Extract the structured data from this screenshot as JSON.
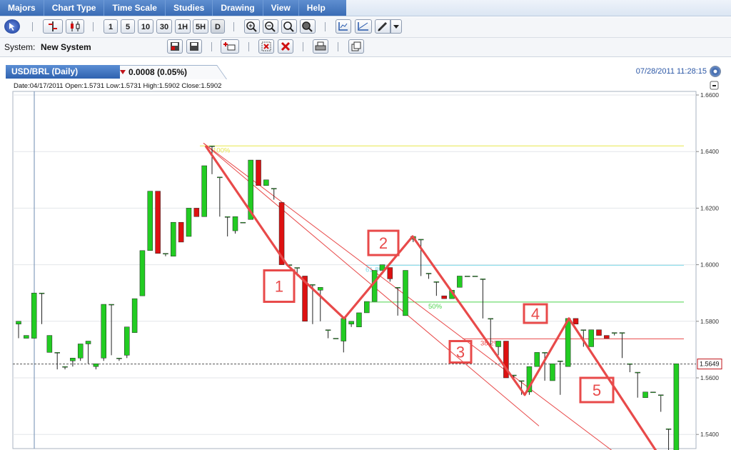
{
  "menu": [
    "Majors",
    "Chart Type",
    "Time Scale",
    "Studies",
    "Drawing",
    "View",
    "Help"
  ],
  "toolbar": {
    "period_buttons": [
      "1",
      "5",
      "10",
      "30",
      "1H",
      "5H",
      "D"
    ]
  },
  "system": {
    "label": "System:",
    "name": "New System"
  },
  "tab": {
    "title": "USD/BRL (Daily)",
    "change": "0.0008 (0.05%)",
    "datetime": "07/28/2011 11:28:15"
  },
  "ohlc_header": "Date:04/17/2011 Open:1.5731 Low:1.5731 High:1.5902 Close:1.5902",
  "colors": {
    "up": "#22cc22",
    "down": "#dd1111",
    "wave": "#e84a4a",
    "fib_100": "#e8e84a",
    "fib_618": "#7fd9e8",
    "fib_50": "#4cd44c",
    "fib_382": "#e84a4a"
  },
  "chart_data": {
    "type": "candlestick",
    "ylim": [
      1.53,
      1.66
    ],
    "y_ticks": [
      "1.6600",
      "1.6400",
      "1.6200",
      "1.6000",
      "1.5800",
      "1.5600",
      "1.5400"
    ],
    "current_price": "1.5649",
    "fib_labels": [
      "100%",
      "61.8%",
      "50%",
      "38.2%"
    ],
    "wave_labels": [
      "1",
      "2",
      "3",
      "4",
      "5"
    ],
    "candles": [
      [
        1.579,
        1.58,
        1.574,
        1.574
      ],
      [
        1.574,
        1.575,
        1.574,
        1.574
      ],
      [
        1.574,
        1.59,
        1.574,
        1.59
      ],
      [
        1.59,
        1.59,
        1.579,
        1.579
      ],
      [
        1.569,
        1.575,
        1.569,
        1.575
      ],
      [
        1.569,
        1.569,
        1.563,
        1.563
      ],
      [
        1.564,
        1.564,
        1.563,
        1.564
      ],
      [
        1.566,
        1.567,
        1.564,
        1.567
      ],
      [
        1.567,
        1.572,
        1.566,
        1.572
      ],
      [
        1.572,
        1.573,
        1.565,
        1.565
      ],
      [
        1.564,
        1.565,
        1.563,
        1.565
      ],
      [
        1.567,
        1.586,
        1.566,
        1.586
      ],
      [
        1.586,
        1.586,
        1.568,
        1.568
      ],
      [
        1.567,
        1.567,
        1.566,
        1.567
      ],
      [
        1.568,
        1.578,
        1.567,
        1.578
      ],
      [
        1.576,
        1.588,
        1.576,
        1.588
      ],
      [
        1.589,
        1.605,
        1.589,
        1.605
      ],
      [
        1.605,
        1.626,
        1.605,
        1.626
      ],
      [
        1.626,
        1.604,
        1.604,
        1.605
      ],
      [
        1.604,
        1.604,
        1.603,
        1.604
      ],
      [
        1.603,
        1.615,
        1.603,
        1.615
      ],
      [
        1.615,
        1.608,
        1.608,
        1.608
      ],
      [
        1.61,
        1.62,
        1.61,
        1.62
      ],
      [
        1.62,
        1.617,
        1.617,
        1.617
      ],
      [
        1.617,
        1.635,
        1.617,
        1.635
      ],
      [
        1.642,
        1.642,
        1.632,
        1.632
      ],
      [
        1.631,
        1.631,
        1.617,
        1.617
      ],
      [
        1.617,
        1.617,
        1.61,
        1.611
      ],
      [
        1.612,
        1.617,
        1.611,
        1.616
      ],
      [
        1.615,
        1.615,
        1.615,
        1.615
      ],
      [
        1.616,
        1.637,
        1.616,
        1.637
      ],
      [
        1.637,
        1.628,
        1.628,
        1.628
      ],
      [
        1.628,
        1.63,
        1.628,
        1.63
      ],
      [
        1.627,
        1.627,
        1.623,
        1.623
      ],
      [
        1.622,
        1.6,
        1.6,
        1.6
      ],
      [
        1.6,
        1.6,
        1.6,
        1.6
      ],
      [
        1.599,
        1.599,
        1.596,
        1.596
      ],
      [
        1.596,
        1.58,
        1.58,
        1.58
      ],
      [
        1.593,
        1.593,
        1.579,
        1.579
      ],
      [
        1.591,
        1.592,
        1.58,
        1.58
      ],
      [
        1.577,
        1.577,
        1.574,
        1.574
      ],
      [
        1.574,
        1.574,
        1.574,
        1.574
      ],
      [
        1.573,
        1.581,
        1.569,
        1.581
      ],
      [
        1.579,
        1.58,
        1.578,
        1.58
      ],
      [
        1.578,
        1.583,
        1.578,
        1.583
      ],
      [
        1.583,
        1.587,
        1.583,
        1.587
      ],
      [
        1.587,
        1.598,
        1.587,
        1.598
      ],
      [
        1.598,
        1.6,
        1.598,
        1.6
      ],
      [
        1.599,
        1.595,
        1.594,
        1.595
      ],
      [
        1.592,
        1.592,
        1.582,
        1.582
      ],
      [
        1.582,
        1.598,
        1.582,
        1.598
      ],
      [
        1.609,
        1.61,
        1.608,
        1.61
      ],
      [
        1.609,
        1.609,
        1.596,
        1.596
      ],
      [
        1.597,
        1.597,
        1.595,
        1.595
      ],
      [
        1.594,
        1.594,
        1.589,
        1.589
      ],
      [
        1.589,
        1.588,
        1.588,
        1.588
      ],
      [
        1.588,
        1.591,
        1.588,
        1.591
      ],
      [
        1.592,
        1.596,
        1.592,
        1.596
      ],
      [
        1.596,
        1.596,
        1.596,
        1.596
      ],
      [
        1.596,
        1.596,
        1.596,
        1.596
      ],
      [
        1.595,
        1.595,
        1.581,
        1.581
      ],
      [
        1.581,
        1.581,
        1.571,
        1.571
      ],
      [
        1.571,
        1.573,
        1.568,
        1.573
      ],
      [
        1.573,
        1.56,
        1.56,
        1.56
      ],
      [
        1.561,
        1.561,
        1.56,
        1.56
      ],
      [
        1.559,
        1.559,
        1.554,
        1.555
      ],
      [
        1.555,
        1.564,
        1.554,
        1.564
      ],
      [
        1.564,
        1.569,
        1.564,
        1.569
      ],
      [
        1.569,
        1.569,
        1.559,
        1.559
      ],
      [
        1.559,
        1.565,
        1.559,
        1.565
      ],
      [
        1.566,
        1.566,
        1.554,
        1.555
      ],
      [
        1.564,
        1.581,
        1.564,
        1.581
      ],
      [
        1.581,
        1.579,
        1.579,
        1.579
      ],
      [
        1.577,
        1.577,
        1.571,
        1.571
      ],
      [
        1.571,
        1.577,
        1.571,
        1.577
      ],
      [
        1.577,
        1.575,
        1.575,
        1.575
      ],
      [
        1.575,
        1.574,
        1.574,
        1.574
      ],
      [
        1.576,
        1.576,
        1.575,
        1.575
      ],
      [
        1.576,
        1.576,
        1.567,
        1.567
      ],
      [
        1.565,
        1.565,
        1.562,
        1.562
      ],
      [
        1.562,
        1.562,
        1.553,
        1.553
      ],
      [
        1.553,
        1.555,
        1.553,
        1.555
      ],
      [
        1.555,
        1.555,
        1.555,
        1.555
      ],
      [
        1.554,
        1.554,
        1.548,
        1.548
      ],
      [
        1.542,
        1.542,
        1.53,
        1.53
      ],
      [
        1.53,
        1.565,
        1.53,
        1.565
      ]
    ]
  }
}
